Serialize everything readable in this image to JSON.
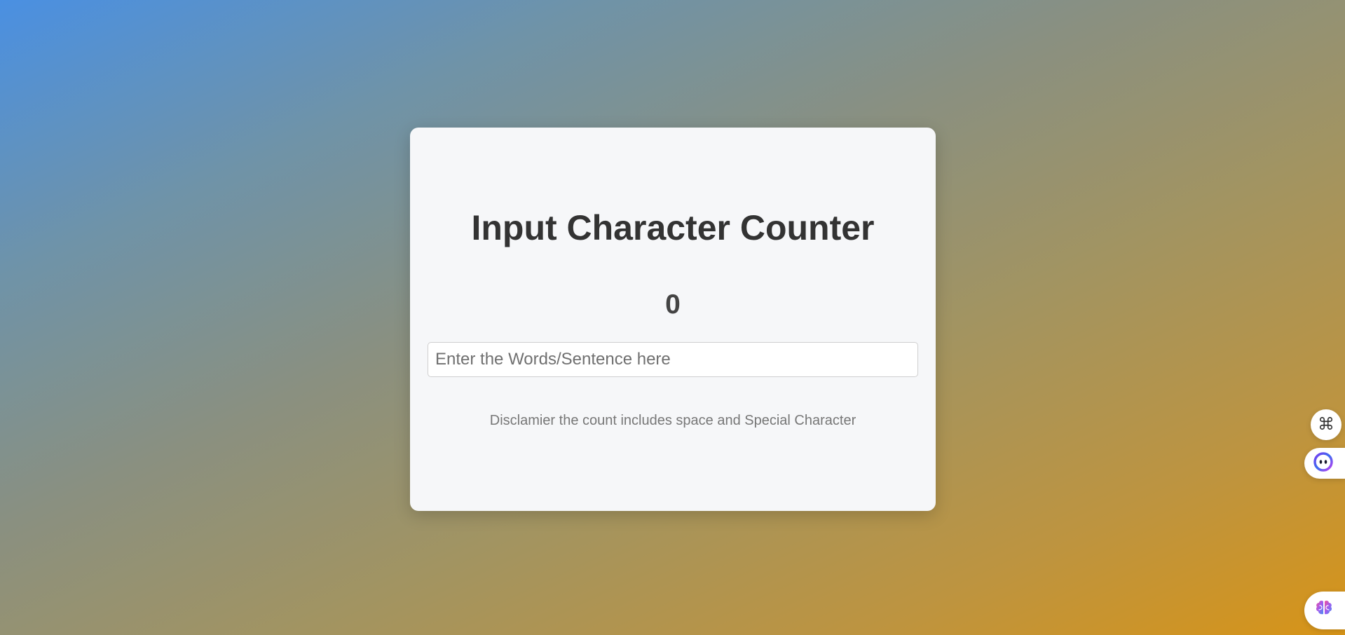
{
  "card": {
    "title": "Input Character Counter",
    "count": "0",
    "input": {
      "value": "",
      "placeholder": "Enter the Words/Sentence here"
    },
    "disclaimer": "Disclamier the count includes space and Special Character"
  },
  "floating_widgets": [
    {
      "icon": "command-icon"
    },
    {
      "icon": "assistant-face-icon"
    },
    {
      "icon": "brain-icon"
    }
  ],
  "colors": {
    "gradient_start": "#4a90e2",
    "gradient_end": "#d79418",
    "card_background": "#f6f7f9",
    "title": "#333333"
  }
}
